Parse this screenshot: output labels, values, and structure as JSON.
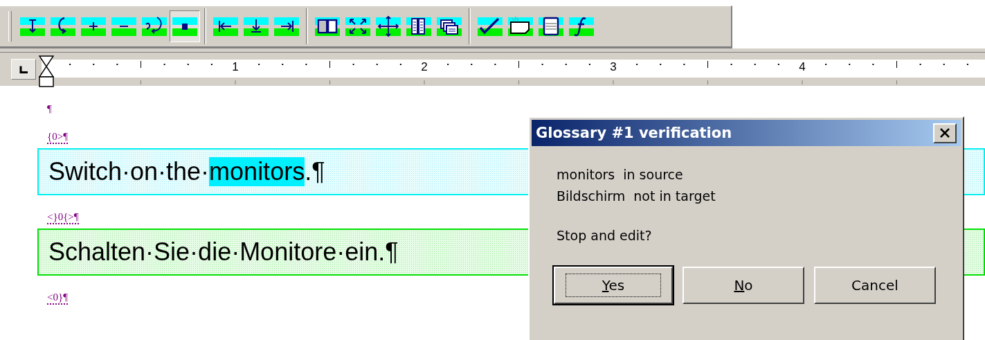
{
  "toolbar": {
    "groups": [
      [
        {
          "kind": "insert-down",
          "selected": false
        },
        {
          "kind": "loop-back",
          "selected": false
        },
        {
          "kind": "plus",
          "selected": false
        },
        {
          "kind": "minus",
          "selected": false
        },
        {
          "kind": "question-loop",
          "selected": false
        },
        {
          "kind": "square",
          "selected": true
        }
      ],
      [
        {
          "kind": "to-start",
          "selected": false
        },
        {
          "kind": "down-bar",
          "selected": false
        },
        {
          "kind": "to-end",
          "selected": false
        }
      ],
      [
        {
          "kind": "book",
          "selected": false
        },
        {
          "kind": "expand",
          "selected": false
        },
        {
          "kind": "move",
          "selected": false
        },
        {
          "kind": "columns",
          "selected": false
        },
        {
          "kind": "windows",
          "selected": false
        }
      ],
      [
        {
          "kind": "check",
          "selected": false
        },
        {
          "kind": "note",
          "selected": false
        },
        {
          "kind": "list",
          "selected": false
        },
        {
          "kind": "function",
          "selected": false
        }
      ]
    ]
  },
  "ruler": {
    "numbers": [
      "1",
      "2",
      "3",
      "4"
    ]
  },
  "document": [
    {
      "kind": "mark",
      "text": "¶"
    },
    {
      "kind": "tag",
      "text": "{0>¶"
    },
    {
      "kind": "source",
      "parts": [
        {
          "text": "Switch·on·the·",
          "highlighted": false
        },
        {
          "text": "monitors",
          "highlighted": true
        },
        {
          "text": ".¶",
          "highlighted": false
        }
      ]
    },
    {
      "kind": "tag",
      "text": "<}0{>¶"
    },
    {
      "kind": "target",
      "parts": [
        {
          "text": "Schalten·Sie·die·Monitore·ein.¶",
          "highlighted": false
        }
      ]
    },
    {
      "kind": "tag",
      "text": "<0}¶"
    }
  ],
  "dialog": {
    "title": "Glossary #1 verification",
    "lines": [
      {
        "term": "monitors",
        "status": "in source"
      },
      {
        "term": "Bildschirm",
        "status": "not in target"
      }
    ],
    "question": "Stop and edit?",
    "buttons": [
      {
        "label": "Yes",
        "underline_first": true,
        "default": true
      },
      {
        "label": "No",
        "underline_first": true,
        "default": false
      },
      {
        "label": "Cancel",
        "underline_first": false,
        "default": false
      }
    ]
  }
}
